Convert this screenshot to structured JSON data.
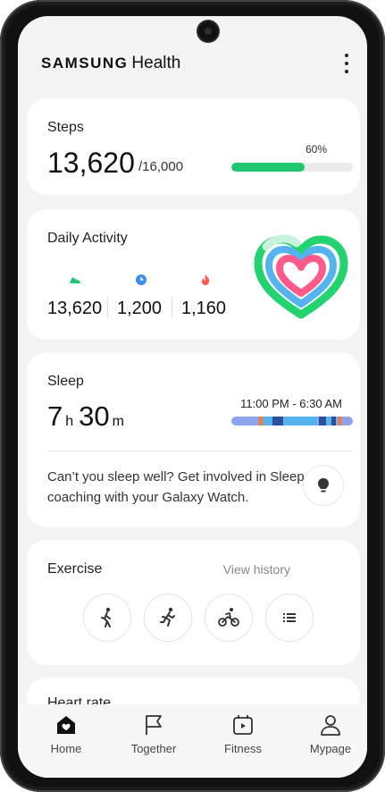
{
  "app": {
    "brand_bold": "SAMSUNG",
    "brand_light": "Health"
  },
  "colors": {
    "accent_green": "#1fc870",
    "sleep_blue": "#8ea4ee",
    "deep_sleep": "#2f4f9a",
    "light_blue": "#55b4f0",
    "activity_pink": "#ff5a8a"
  },
  "steps": {
    "title": "Steps",
    "count": "13,620",
    "goal": "/16,000",
    "percent": "60%",
    "progress": 0.6
  },
  "daily_activity": {
    "title": "Daily Activity",
    "metrics": [
      {
        "icon": "shoe-icon",
        "value": "13,620"
      },
      {
        "icon": "clock-icon",
        "value": "1,200"
      },
      {
        "icon": "flame-icon",
        "value": "1,160"
      }
    ]
  },
  "sleep": {
    "title": "Sleep",
    "hours": "7",
    "hours_unit": "h",
    "minutes": "30",
    "minutes_unit": "m",
    "range": "11:00 PM - 6:30 AM",
    "tip": "Can’t you sleep well? Get involved in Sleep coaching with your Galaxy Watch."
  },
  "exercise": {
    "title": "Exercise",
    "view_history": "View history",
    "buttons": [
      {
        "icon": "walk-icon"
      },
      {
        "icon": "run-icon"
      },
      {
        "icon": "cycle-icon"
      },
      {
        "icon": "list-icon"
      }
    ]
  },
  "heart_rate": {
    "title": "Heart rate"
  },
  "nav": [
    {
      "label": "Home",
      "icon": "home-icon"
    },
    {
      "label": "Together",
      "icon": "flag-icon"
    },
    {
      "label": "Fitness",
      "icon": "fitness-icon"
    },
    {
      "label": "Mypage",
      "icon": "person-icon"
    }
  ]
}
